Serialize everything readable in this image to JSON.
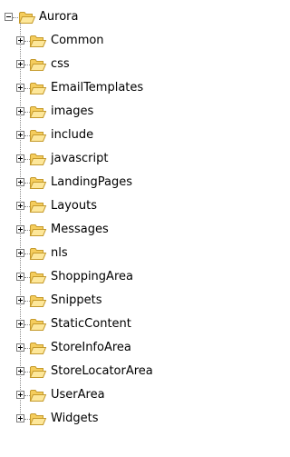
{
  "tree": {
    "root": {
      "label": "Aurora",
      "expanded": true,
      "icon": "open-folder-icon"
    },
    "children": [
      {
        "label": "Common",
        "expanded": false,
        "icon": "open-folder-icon"
      },
      {
        "label": "css",
        "expanded": false,
        "icon": "open-folder-icon"
      },
      {
        "label": "EmailTemplates",
        "expanded": false,
        "icon": "open-folder-icon"
      },
      {
        "label": "images",
        "expanded": false,
        "icon": "open-folder-icon"
      },
      {
        "label": "include",
        "expanded": false,
        "icon": "open-folder-icon"
      },
      {
        "label": "javascript",
        "expanded": false,
        "icon": "open-folder-icon"
      },
      {
        "label": "LandingPages",
        "expanded": false,
        "icon": "open-folder-icon"
      },
      {
        "label": "Layouts",
        "expanded": false,
        "icon": "open-folder-icon"
      },
      {
        "label": "Messages",
        "expanded": false,
        "icon": "open-folder-icon"
      },
      {
        "label": "nls",
        "expanded": false,
        "icon": "open-folder-icon"
      },
      {
        "label": "ShoppingArea",
        "expanded": false,
        "icon": "open-folder-icon"
      },
      {
        "label": "Snippets",
        "expanded": false,
        "icon": "open-folder-icon"
      },
      {
        "label": "StaticContent",
        "expanded": false,
        "icon": "open-folder-icon"
      },
      {
        "label": "StoreInfoArea",
        "expanded": false,
        "icon": "open-folder-icon"
      },
      {
        "label": "StoreLocatorArea",
        "expanded": false,
        "icon": "open-folder-icon"
      },
      {
        "label": "UserArea",
        "expanded": false,
        "icon": "open-folder-icon"
      },
      {
        "label": "Widgets",
        "expanded": false,
        "icon": "open-folder-icon"
      }
    ]
  },
  "colors": {
    "folder_fill": "#fde79a",
    "folder_stroke": "#c59a2c",
    "folder_shade": "#f5cd5d",
    "tree_line": "#8c8c8c",
    "expander_border": "#7b7b7b"
  }
}
